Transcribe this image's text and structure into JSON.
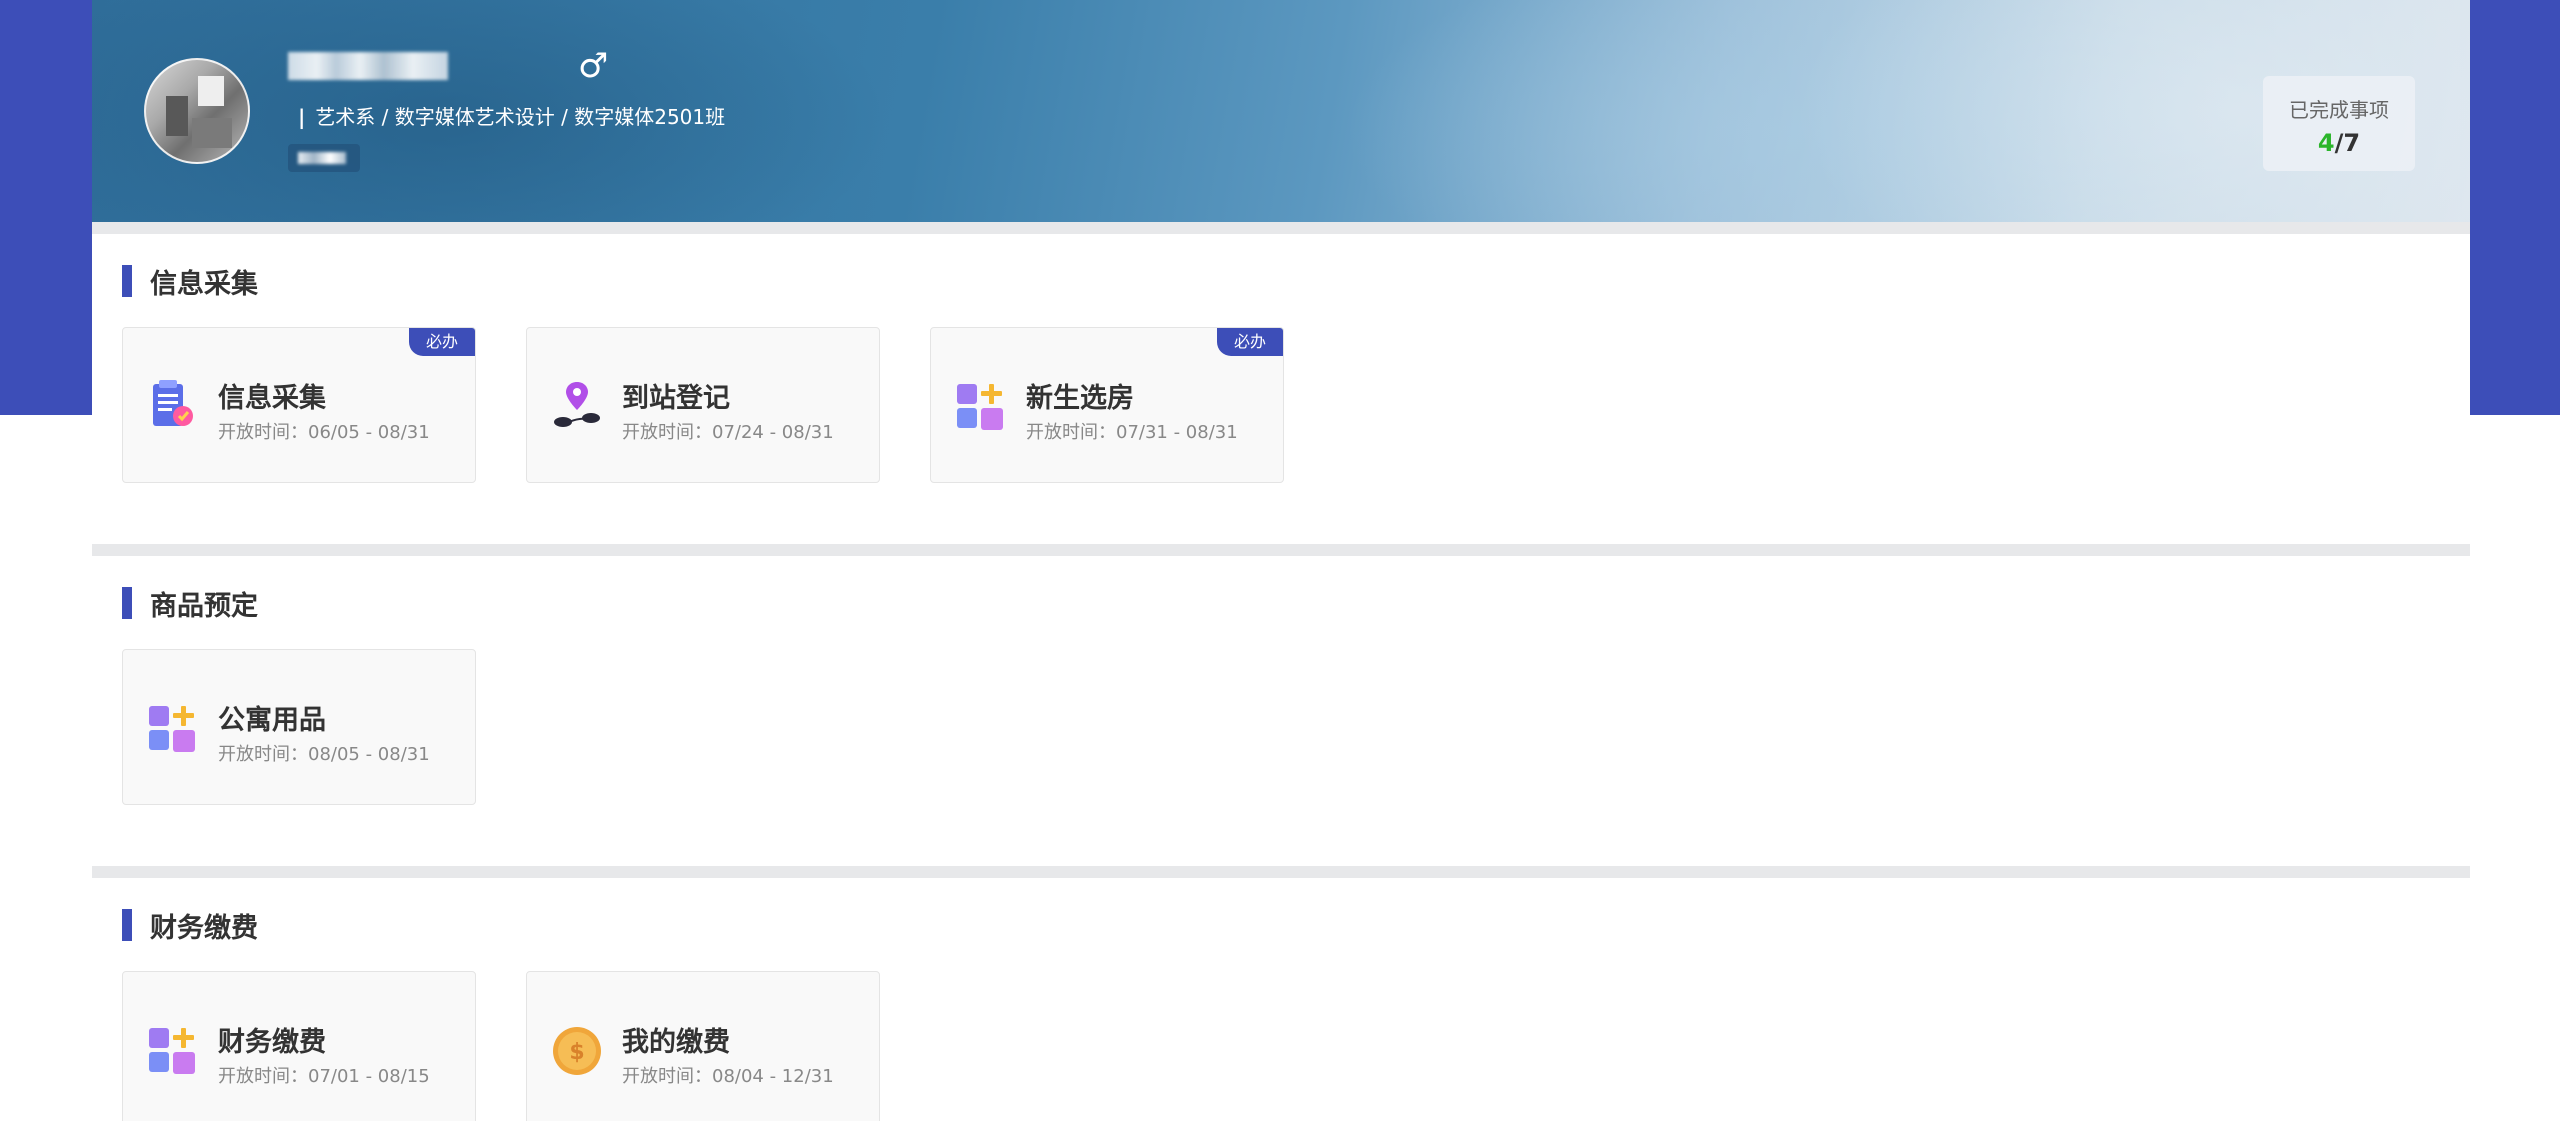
{
  "profile": {
    "gender_symbol": "♂",
    "department": "艺术系 / 数字媒体艺术设计 / 数字媒体2501班",
    "divider": "|"
  },
  "progress": {
    "label": "已完成事项",
    "done": "4",
    "total": "/7"
  },
  "sections": [
    {
      "title": "信息采集",
      "cards": [
        {
          "title": "信息采集",
          "time": "开放时间：06/05 - 08/31",
          "badge": "必办",
          "icon": "form-clipboard-icon"
        },
        {
          "title": "到站登记",
          "time": "开放时间：07/24 - 08/31",
          "badge": "",
          "icon": "location-pin-icon"
        },
        {
          "title": "新生选房",
          "time": "开放时间：07/31 - 08/31",
          "badge": "必办",
          "icon": "app-blocks-icon"
        }
      ]
    },
    {
      "title": "商品预定",
      "cards": [
        {
          "title": "公寓用品",
          "time": "开放时间：08/05 - 08/31",
          "badge": "",
          "icon": "app-blocks-icon"
        }
      ]
    },
    {
      "title": "财务缴费",
      "cards": [
        {
          "title": "财务缴费",
          "time": "开放时间：07/01 - 08/15",
          "badge": "",
          "icon": "app-blocks-icon"
        },
        {
          "title": "我的缴费",
          "time": "开放时间：08/04 - 12/31",
          "badge": "",
          "icon": "dollar-coin-icon"
        }
      ]
    }
  ],
  "colors": {
    "primary": "#3d4eb8",
    "done_green": "#2bb52b",
    "text_dark": "#333333",
    "text_muted": "#888888"
  }
}
